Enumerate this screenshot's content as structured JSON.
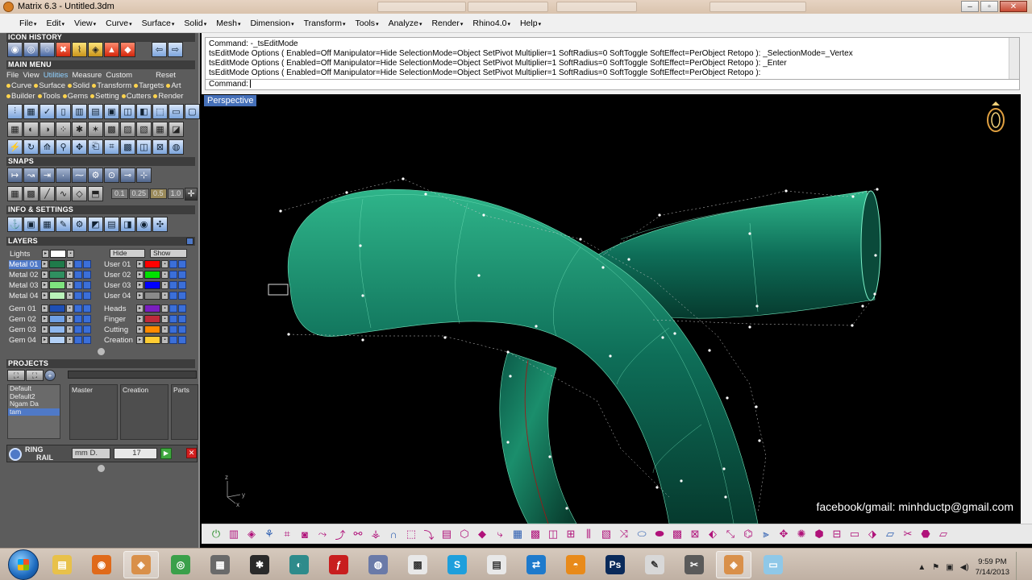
{
  "window": {
    "title": "Matrix 6.3 - Untitled.3dm",
    "controls": {
      "minimize": "–",
      "maximize": "▫",
      "close": "✕"
    }
  },
  "menubar": [
    "File",
    "Edit",
    "View",
    "Curve",
    "Surface",
    "Solid",
    "Mesh",
    "Dimension",
    "Transform",
    "Tools",
    "Analyze",
    "Render",
    "Rhino4.0",
    "Help"
  ],
  "left_panel": {
    "icon_history_title": "ICON HISTORY",
    "main_menu_title": "MAIN MENU",
    "main_menu_tabs": [
      "File",
      "View",
      "Utilities",
      "Measure",
      "Custom"
    ],
    "main_menu_reset": "Reset",
    "categories_row1": [
      "Curve",
      "Surface",
      "Solid",
      "Transform",
      "Targets",
      "Art"
    ],
    "categories_row2": [
      "Builder",
      "Tools",
      "Gems",
      "Setting",
      "Cutters",
      "Render"
    ],
    "snaps_title": "SNAPS",
    "snap_values": [
      "0.1",
      "0.25",
      "0.5",
      "1.0"
    ],
    "info_title": "INFO & SETTINGS",
    "layers_title": "LAYERS",
    "lights_label": "Lights",
    "hide_label": "Hide",
    "show_label": "Show",
    "layers_left": [
      {
        "name": "Metal 01",
        "color": "#1f7a4a",
        "selected": true
      },
      {
        "name": "Metal 02",
        "color": "#2f8f60",
        "selected": false
      },
      {
        "name": "Metal 03",
        "color": "#7fe37f",
        "selected": false
      },
      {
        "name": "Metal 04",
        "color": "#b9f2b9",
        "selected": false
      },
      {
        "name": "Gem 01",
        "color": "#1e4fb5",
        "selected": false
      },
      {
        "name": "Gem 02",
        "color": "#6fa0e6",
        "selected": false
      },
      {
        "name": "Gem 03",
        "color": "#8fb8f0",
        "selected": false
      },
      {
        "name": "Gem 04",
        "color": "#b3d1f7",
        "selected": false
      }
    ],
    "layers_right": [
      {
        "name": "User 01",
        "color": "#ff0000"
      },
      {
        "name": "User 02",
        "color": "#00e000"
      },
      {
        "name": "User 03",
        "color": "#0000ff"
      },
      {
        "name": "User 04",
        "color": "#8a8a8a"
      },
      {
        "name": "Heads",
        "color": "#7a1fbf"
      },
      {
        "name": "Finger",
        "color": "#bf2a3a"
      },
      {
        "name": "Cutting",
        "color": "#ff8a00"
      },
      {
        "name": "Creation",
        "color": "#ffcc33"
      }
    ],
    "projects_title": "PROJECTS",
    "projects": [
      {
        "name": "Default",
        "selected": false
      },
      {
        "name": "Default2",
        "selected": false
      },
      {
        "name": "Ngam Da",
        "selected": false
      },
      {
        "name": "tam",
        "selected": true
      }
    ],
    "project_columns": [
      "Master",
      "Creation",
      "Parts"
    ],
    "ring_label_line1": "RING",
    "ring_label_line2": "RAIL",
    "ring_unit": "mm D.",
    "ring_value": "17"
  },
  "command": {
    "history": [
      "Command: -_tsEditMode",
      "tsEditMode Options ( Enabled=Off  Manipulator=Hide  SelectionMode=Object  SetPivot  Multiplier=1  SoftRadius=0  SoftToggle  SoftEffect=PerObject  Retopo ): _SelectionMode=_Vertex",
      "tsEditMode Options ( Enabled=Off  Manipulator=Hide  SelectionMode=Object  SetPivot  Multiplier=1  SoftRadius=0  SoftToggle  SoftEffect=PerObject  Retopo ): _Enter",
      "tsEditMode Options ( Enabled=Off  Manipulator=Hide  SelectionMode=Object  SetPivot  Multiplier=1  SoftRadius=0  SoftToggle  SoftEffect=PerObject  Retopo ):"
    ],
    "prompt_label": "Command:"
  },
  "viewport": {
    "name": "Perspective",
    "credit": "facebook/gmail: minhductp@gmail.com",
    "axis_labels": {
      "x": "x",
      "y": "y",
      "z": "z"
    },
    "colors": {
      "surface": "#0e6e58",
      "surface_light": "#35c79a",
      "background": "#000000"
    }
  },
  "taskbar": {
    "apps": [
      "explorer-icon",
      "firefox-icon",
      "matrix-icon",
      "chrome-icon",
      "editor-icon",
      "3d-app-icon",
      "sphere-app-icon",
      "flash-icon",
      "orb-icon",
      "grid-app-icon",
      "skype-icon",
      "notepad-icon",
      "teamviewer-icon",
      "blender-icon",
      "photoshop-icon",
      "paint-icon",
      "sketch-icon",
      "matrix-icon-2",
      "window-icon"
    ],
    "time": "9:59 PM",
    "date": "7/14/2013"
  }
}
